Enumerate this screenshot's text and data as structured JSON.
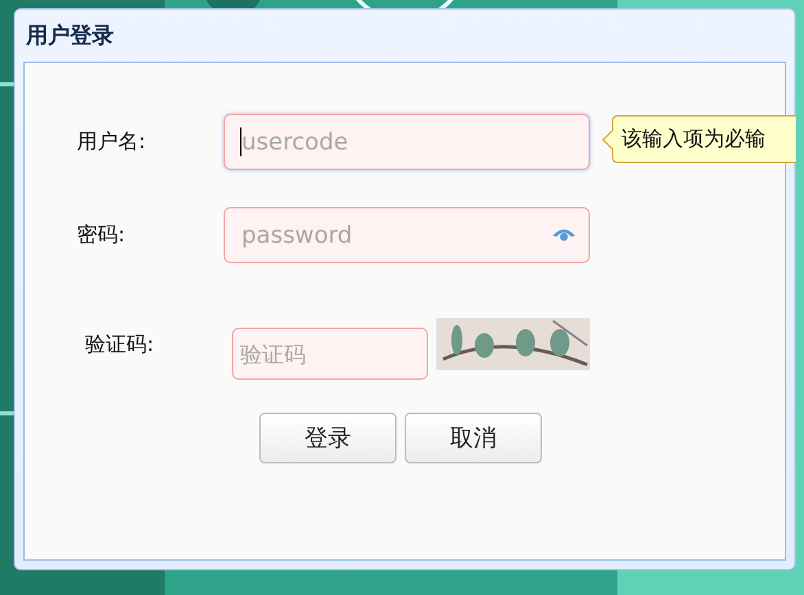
{
  "window": {
    "title": "用户登录"
  },
  "fields": [
    {
      "label": "用户名:",
      "kind": "text",
      "placeholder": "usercode",
      "focused": true,
      "invalid": true,
      "tooltip": "该输入项为必输"
    },
    {
      "label": "密码:",
      "kind": "password",
      "placeholder": "password",
      "focused": false,
      "invalid": true
    },
    {
      "label": "验证码:",
      "kind": "captcha",
      "placeholder": "验证码",
      "focused": false,
      "invalid": true
    }
  ],
  "buttons": [
    {
      "label": "登录"
    },
    {
      "label": "取消"
    }
  ]
}
